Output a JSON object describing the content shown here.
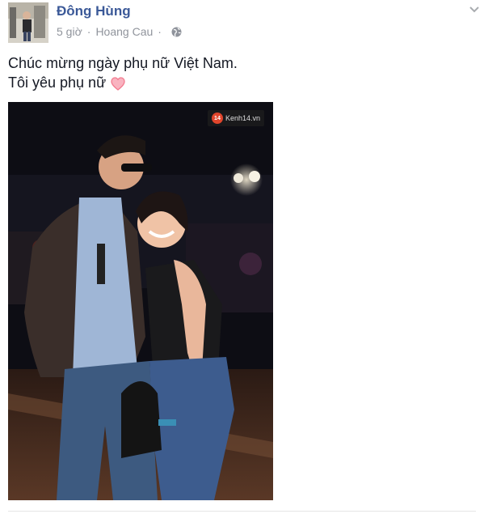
{
  "post": {
    "author": "Đông Hùng",
    "time": "5 giờ",
    "separator": "·",
    "location": "Hoang Cau",
    "privacy_icon": "globe-icon",
    "menu_icon": "chevron-down-icon",
    "text_lines": [
      "Chúc mừng ngày phụ nữ Việt Nam.",
      "Tôi yêu phụ nữ"
    ],
    "emoji": "heart-icon",
    "photo": {
      "watermark_logo": "14",
      "watermark_text": "Kenh14.vn"
    }
  },
  "colors": {
    "author_link": "#3b5998",
    "meta_text": "#90949c",
    "body_text": "#141823",
    "heart": "#f37a8f"
  }
}
